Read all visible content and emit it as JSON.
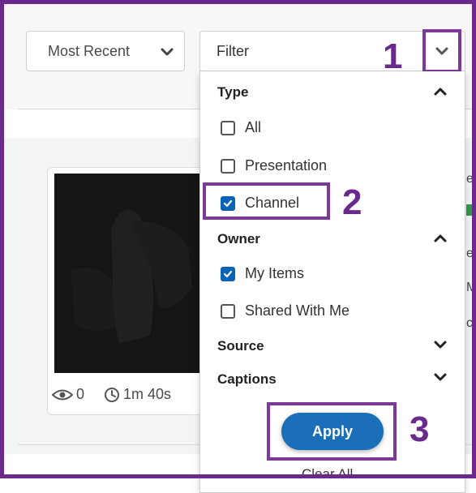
{
  "sort": {
    "value": "Most Recent"
  },
  "filter": {
    "label": "Filter"
  },
  "sections": {
    "type": {
      "label": "Type",
      "options": [
        "All",
        "Presentation",
        "Channel"
      ]
    },
    "owner": {
      "label": "Owner",
      "options": [
        "My Items",
        "Shared With Me"
      ]
    },
    "source": {
      "label": "Source"
    },
    "captions": {
      "label": "Captions"
    }
  },
  "checked": {
    "all": false,
    "presentation": false,
    "channel": true,
    "my_items": true,
    "shared_with_me": false
  },
  "card": {
    "views": "0",
    "duration": "1m 40s"
  },
  "steps": [
    "1",
    "2",
    "3"
  ],
  "actions": {
    "apply": "Apply",
    "clear_all": "Clear All"
  },
  "colors": {
    "annotation": "#6a2a8c",
    "primary": "#1a6fb8",
    "checkbox_checked": "#0b63b6"
  },
  "side_fragments": [
    "e",
    "e",
    "M",
    "c"
  ]
}
